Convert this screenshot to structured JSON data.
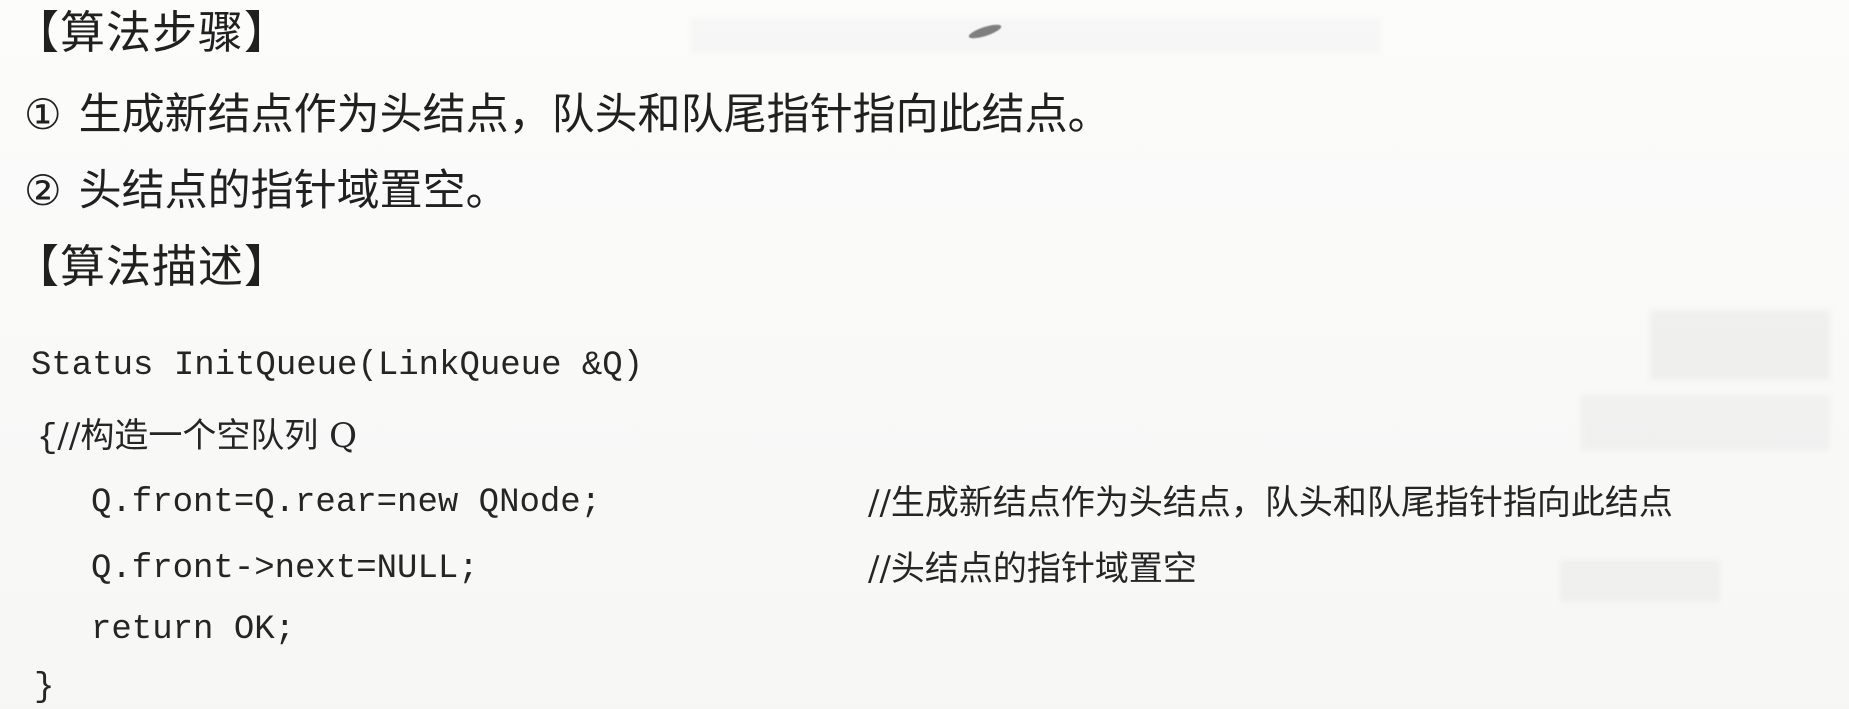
{
  "section1": {
    "heading": "【算法步骤】",
    "steps": [
      {
        "marker": "①",
        "text": "生成新结点作为头结点，队头和队尾指针指向此结点。"
      },
      {
        "marker": "②",
        "text": "头结点的指针域置空。"
      }
    ]
  },
  "section2": {
    "heading": "【算法描述】"
  },
  "code": {
    "signature": "Status InitQueue(LinkQueue &Q)",
    "open_brace": "{",
    "open_comment": "//构造一个空队列 Q",
    "lines": [
      {
        "code": "Q.front=Q.rear=new QNode;",
        "comment": "//生成新结点作为头结点，队头和队尾指针指向此结点"
      },
      {
        "code": "Q.front->next=NULL;",
        "comment": "//头结点的指针域置空"
      },
      {
        "code": "return OK;",
        "comment": ""
      }
    ],
    "close_brace": "}"
  }
}
